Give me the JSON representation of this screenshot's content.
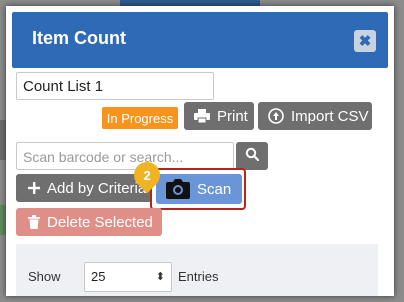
{
  "modal": {
    "title": "Item Count",
    "close_icon": "close-icon"
  },
  "count_list": {
    "value": "Count List 1"
  },
  "status": {
    "label": "In Progress",
    "color": "#f7941d"
  },
  "toolbar": {
    "print_label": "Print",
    "import_label": "Import CSV"
  },
  "search": {
    "placeholder": "Scan barcode or search..."
  },
  "actions": {
    "add_criteria_label": "Add by Criteria",
    "scan_label": "Scan",
    "delete_label": "Delete Selected",
    "step_number": "2"
  },
  "table": {
    "show_label": "Show",
    "entries_value": "25",
    "entries_label": "Entries"
  },
  "colors": {
    "header": "#2f6ab7",
    "scan_button": "#6a95d6",
    "delete_button": "#e08f88",
    "highlight": "#b3261e",
    "step_badge": "#f0b323"
  }
}
